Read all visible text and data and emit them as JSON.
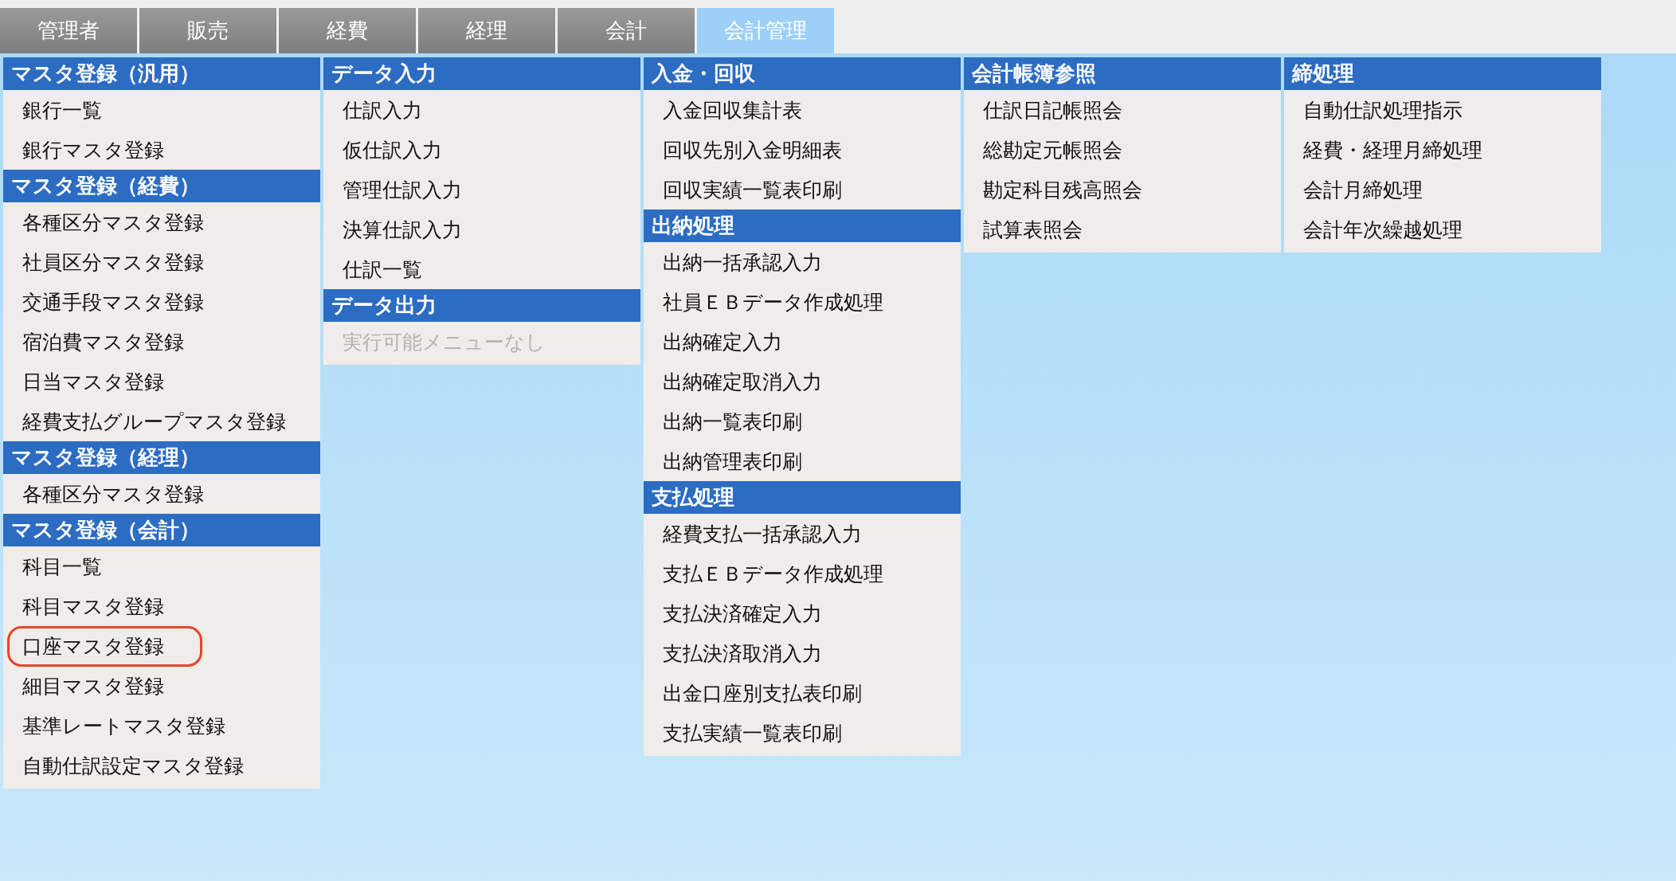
{
  "tabs": [
    {
      "label": "管理者",
      "selected": false
    },
    {
      "label": "販売",
      "selected": false
    },
    {
      "label": "経費",
      "selected": false
    },
    {
      "label": "経理",
      "selected": false
    },
    {
      "label": "会計",
      "selected": false
    },
    {
      "label": "会計管理",
      "selected": true
    }
  ],
  "columns": [
    {
      "sections": [
        {
          "heading": "マスタ登録（汎用）",
          "items": [
            {
              "label": "銀行一覧",
              "disabled": false,
              "circled": false
            },
            {
              "label": "銀行マスタ登録",
              "disabled": false,
              "circled": false
            }
          ]
        },
        {
          "heading": "マスタ登録（経費）",
          "items": [
            {
              "label": "各種区分マスタ登録",
              "disabled": false,
              "circled": false
            },
            {
              "label": "社員区分マスタ登録",
              "disabled": false,
              "circled": false
            },
            {
              "label": "交通手段マスタ登録",
              "disabled": false,
              "circled": false
            },
            {
              "label": "宿泊費マスタ登録",
              "disabled": false,
              "circled": false
            },
            {
              "label": "日当マスタ登録",
              "disabled": false,
              "circled": false
            },
            {
              "label": "経費支払グループマスタ登録",
              "disabled": false,
              "circled": false
            }
          ]
        },
        {
          "heading": "マスタ登録（経理）",
          "items": [
            {
              "label": "各種区分マスタ登録",
              "disabled": false,
              "circled": false
            }
          ]
        },
        {
          "heading": "マスタ登録（会計）",
          "items": [
            {
              "label": "科目一覧",
              "disabled": false,
              "circled": false
            },
            {
              "label": "科目マスタ登録",
              "disabled": false,
              "circled": false
            },
            {
              "label": "口座マスタ登録",
              "disabled": false,
              "circled": true
            },
            {
              "label": "細目マスタ登録",
              "disabled": false,
              "circled": false
            },
            {
              "label": "基準レートマスタ登録",
              "disabled": false,
              "circled": false
            },
            {
              "label": "自動仕訳設定マスタ登録",
              "disabled": false,
              "circled": false
            }
          ]
        }
      ]
    },
    {
      "sections": [
        {
          "heading": "データ入力",
          "items": [
            {
              "label": "仕訳入力",
              "disabled": false,
              "circled": false
            },
            {
              "label": "仮仕訳入力",
              "disabled": false,
              "circled": false
            },
            {
              "label": "管理仕訳入力",
              "disabled": false,
              "circled": false
            },
            {
              "label": "決算仕訳入力",
              "disabled": false,
              "circled": false
            },
            {
              "label": "仕訳一覧",
              "disabled": false,
              "circled": false
            }
          ]
        },
        {
          "heading": "データ出力",
          "items": [
            {
              "label": "実行可能メニューなし",
              "disabled": true,
              "circled": false
            }
          ]
        }
      ]
    },
    {
      "sections": [
        {
          "heading": "入金・回収",
          "items": [
            {
              "label": "入金回収集計表",
              "disabled": false,
              "circled": false
            },
            {
              "label": "回収先別入金明細表",
              "disabled": false,
              "circled": false
            },
            {
              "label": "回収実績一覧表印刷",
              "disabled": false,
              "circled": false
            }
          ]
        },
        {
          "heading": "出納処理",
          "items": [
            {
              "label": "出納一括承認入力",
              "disabled": false,
              "circled": false
            },
            {
              "label": "社員ＥＢデータ作成処理",
              "disabled": false,
              "circled": false
            },
            {
              "label": "出納確定入力",
              "disabled": false,
              "circled": false
            },
            {
              "label": "出納確定取消入力",
              "disabled": false,
              "circled": false
            },
            {
              "label": "出納一覧表印刷",
              "disabled": false,
              "circled": false
            },
            {
              "label": "出納管理表印刷",
              "disabled": false,
              "circled": false
            }
          ]
        },
        {
          "heading": "支払処理",
          "items": [
            {
              "label": "経費支払一括承認入力",
              "disabled": false,
              "circled": false
            },
            {
              "label": "支払ＥＢデータ作成処理",
              "disabled": false,
              "circled": false
            },
            {
              "label": "支払決済確定入力",
              "disabled": false,
              "circled": false
            },
            {
              "label": "支払決済取消入力",
              "disabled": false,
              "circled": false
            },
            {
              "label": "出金口座別支払表印刷",
              "disabled": false,
              "circled": false
            },
            {
              "label": "支払実績一覧表印刷",
              "disabled": false,
              "circled": false
            }
          ]
        }
      ]
    },
    {
      "sections": [
        {
          "heading": "会計帳簿参照",
          "items": [
            {
              "label": "仕訳日記帳照会",
              "disabled": false,
              "circled": false
            },
            {
              "label": "総勘定元帳照会",
              "disabled": false,
              "circled": false
            },
            {
              "label": "勘定科目残高照会",
              "disabled": false,
              "circled": false
            },
            {
              "label": "試算表照会",
              "disabled": false,
              "circled": false
            }
          ]
        }
      ]
    },
    {
      "sections": [
        {
          "heading": "締処理",
          "items": [
            {
              "label": "自動仕訳処理指示",
              "disabled": false,
              "circled": false
            },
            {
              "label": "経費・経理月締処理",
              "disabled": false,
              "circled": false
            },
            {
              "label": "会計月締処理",
              "disabled": false,
              "circled": false
            },
            {
              "label": "会計年次繰越処理",
              "disabled": false,
              "circled": false
            }
          ]
        }
      ]
    }
  ]
}
